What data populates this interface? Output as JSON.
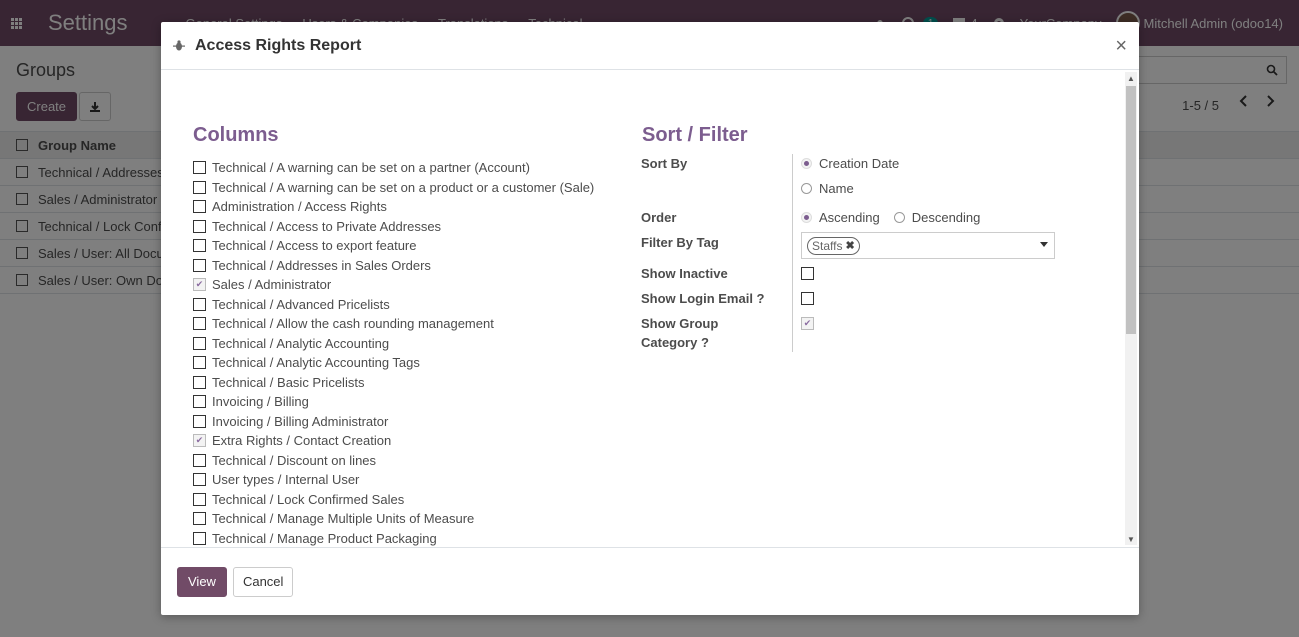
{
  "app": {
    "title": "Settings",
    "menu": [
      "General Settings",
      "Users & Companies",
      "Translations",
      "Technical"
    ],
    "company": "YourCompany",
    "user": "Mitchell Admin (odoo14)",
    "activity_count": "1",
    "message_count": "4"
  },
  "control_panel": {
    "breadcrumb": "Groups",
    "create_label": "Create",
    "pager": "1-5 / 5"
  },
  "list": {
    "header": "Group Name",
    "rows": [
      "Technical / Addresses in Sales Orders",
      "Sales / Administrator",
      "Technical / Lock Confirmed Sales",
      "Sales / User: All Documents",
      "Sales / User: Own Documents Only"
    ]
  },
  "dialog": {
    "title": "Access Rights Report",
    "close_glyph": "×",
    "columns_title": "Columns",
    "sort_title": "Sort / Filter",
    "columns": [
      {
        "label": "Technical / A warning can be set on a partner (Account)",
        "checked": false
      },
      {
        "label": "Technical / A warning can be set on a product or a customer (Sale)",
        "checked": false
      },
      {
        "label": "Administration / Access Rights",
        "checked": false
      },
      {
        "label": "Technical / Access to Private Addresses",
        "checked": false
      },
      {
        "label": "Technical / Access to export feature",
        "checked": false
      },
      {
        "label": "Technical / Addresses in Sales Orders",
        "checked": false
      },
      {
        "label": "Sales / Administrator",
        "checked": true
      },
      {
        "label": "Technical / Advanced Pricelists",
        "checked": false
      },
      {
        "label": "Technical / Allow the cash rounding management",
        "checked": false
      },
      {
        "label": "Technical / Analytic Accounting",
        "checked": false
      },
      {
        "label": "Technical / Analytic Accounting Tags",
        "checked": false
      },
      {
        "label": "Technical / Basic Pricelists",
        "checked": false
      },
      {
        "label": "Invoicing / Billing",
        "checked": false
      },
      {
        "label": "Invoicing / Billing Administrator",
        "checked": false
      },
      {
        "label": "Extra Rights / Contact Creation",
        "checked": true
      },
      {
        "label": "Technical / Discount on lines",
        "checked": false
      },
      {
        "label": "User types / Internal User",
        "checked": false
      },
      {
        "label": "Technical / Lock Confirmed Sales",
        "checked": false
      },
      {
        "label": "Technical / Manage Multiple Units of Measure",
        "checked": false
      },
      {
        "label": "Technical / Manage Product Packaging",
        "checked": false
      }
    ],
    "sort_by_label": "Sort By",
    "sort_options": [
      "Creation Date",
      "Name"
    ],
    "sort_selected": "Creation Date",
    "order_label": "Order",
    "order_options": [
      "Ascending",
      "Descending"
    ],
    "order_selected": "Ascending",
    "filter_tag_label": "Filter By Tag",
    "filter_tag_value": "Staffs",
    "show_inactive_label": "Show Inactive",
    "show_inactive": false,
    "show_login_label": "Show Login Email ?",
    "show_login": false,
    "show_group_category_label_1": "Show Group",
    "show_group_category_label_2": "Category ?",
    "show_group_category": true,
    "view_label": "View",
    "cancel_label": "Cancel"
  },
  "colors": {
    "brand": "#714b67",
    "section_title": "#7c5d8f"
  }
}
